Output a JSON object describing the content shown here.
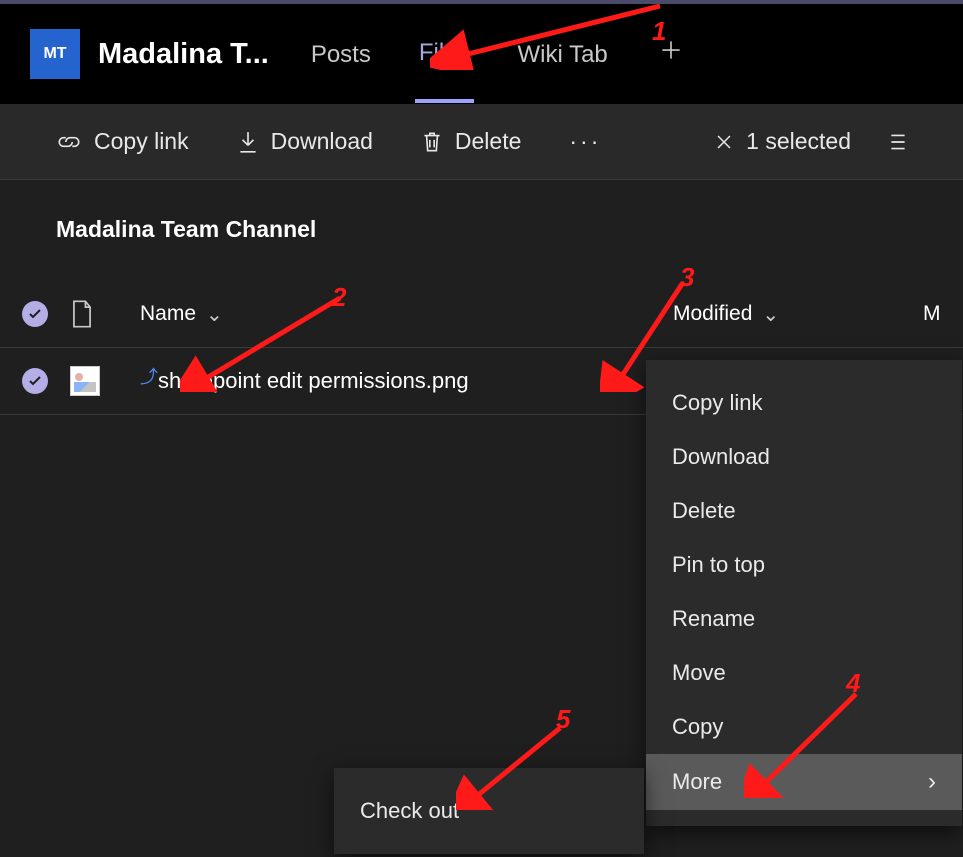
{
  "header": {
    "avatar_label": "MT",
    "team_title": "Madalina T...",
    "tabs": [
      "Posts",
      "Files",
      "Wiki Tab"
    ],
    "active_tab_index": 1
  },
  "commandbar": {
    "copylink": "Copy link",
    "download": "Download",
    "delete": "Delete",
    "selection": "1 selected"
  },
  "breadcrumb": "Madalina Team Channel",
  "columns": {
    "name": "Name",
    "modified": "Modified",
    "more": "M"
  },
  "row": {
    "filename": "sharepoint edit permissions.png"
  },
  "context_menu": {
    "items": [
      "Copy link",
      "Download",
      "Delete",
      "Pin to top",
      "Rename",
      "Move",
      "Copy",
      "More"
    ]
  },
  "submenu": {
    "items": [
      "Check out"
    ]
  },
  "annotations": {
    "n1": "1",
    "n2": "2",
    "n3": "3",
    "n4": "4",
    "n5": "5"
  }
}
